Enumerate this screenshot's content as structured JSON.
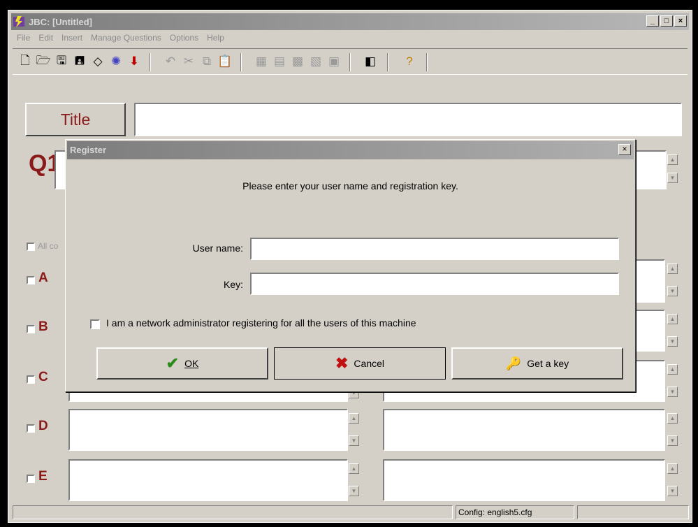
{
  "window": {
    "title": "JBC: [Untitled]"
  },
  "menu": [
    "File",
    "Edit",
    "Insert",
    "Manage Questions",
    "Options",
    "Help"
  ],
  "toolbar": {
    "icons": [
      "new-icon",
      "open-icon",
      "save-icon",
      "save-as-icon",
      "eraser-icon",
      "web-icon",
      "down-arrow-icon",
      "undo-icon",
      "cut-icon",
      "copy-icon",
      "paste-icon",
      "tool-a-icon",
      "tool-b-icon",
      "tool-c-icon",
      "tool-d-icon",
      "tool-e-icon",
      "export-icon",
      "help-icon"
    ]
  },
  "main": {
    "title_button": "Title",
    "title_value": "",
    "question_label": "Q1",
    "all_correct_label": "All co",
    "answers": [
      "A",
      "B",
      "C",
      "D",
      "E"
    ]
  },
  "status": {
    "config": "Config: english5.cfg"
  },
  "dialog": {
    "title": "Register",
    "close": "×",
    "prompt": "Please enter your user name and registration key.",
    "user_label": "User name:",
    "user_value": "",
    "key_label": "Key:",
    "key_value": "",
    "admin_checkbox": "I am a network administrator registering for all the users of this machine",
    "ok": "OK",
    "cancel": "Cancel",
    "getkey": "Get a key"
  },
  "colors": {
    "accent": "#8b1a1a",
    "face": "#d4d0c8",
    "titlebar": "#808080"
  }
}
